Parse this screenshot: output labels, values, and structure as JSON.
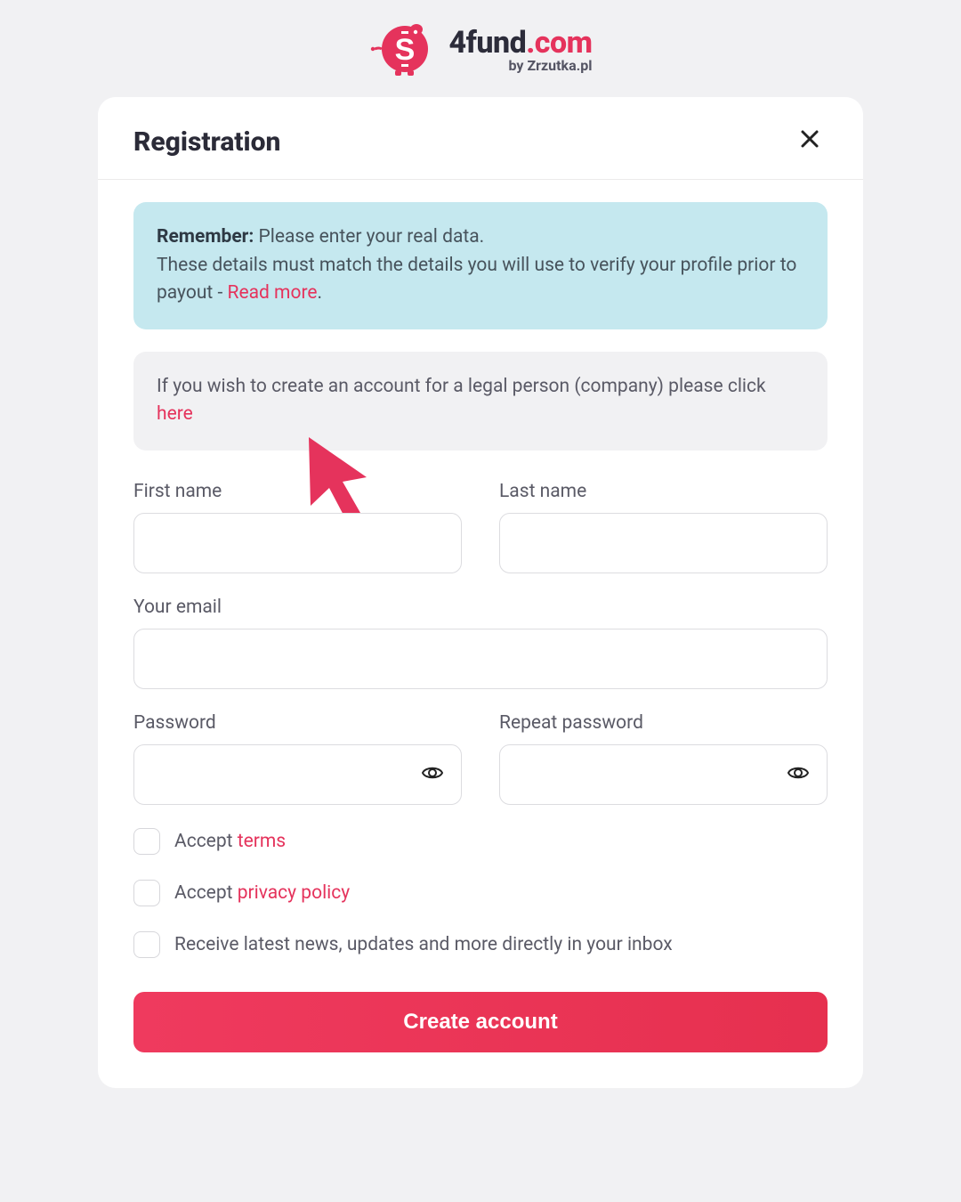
{
  "brand": {
    "name_part1": "4fund",
    "name_part2": ".com",
    "byline": "by Zrzutka.pl"
  },
  "modal": {
    "title": "Registration"
  },
  "info_blue": {
    "strong": "Remember:",
    "line1": " Please enter your real data.",
    "line2a": "These details must match the details you will use to verify your profile prior to payout - ",
    "link": "Read more",
    "line2b": "."
  },
  "info_grey": {
    "text_a": "If you wish to create an account for a legal person (company) please click ",
    "link": "here"
  },
  "fields": {
    "first_name": "First name",
    "last_name": "Last name",
    "email": "Your email",
    "password": "Password",
    "repeat_password": "Repeat password"
  },
  "checkboxes": {
    "terms_prefix": "Accept ",
    "terms_link": "terms",
    "privacy_prefix": "Accept ",
    "privacy_link": "privacy policy",
    "newsletter": "Receive latest news, updates and more directly in your inbox"
  },
  "submit": "Create account",
  "colors": {
    "accent": "#e5335c",
    "info_bg": "#c5e8ef"
  }
}
